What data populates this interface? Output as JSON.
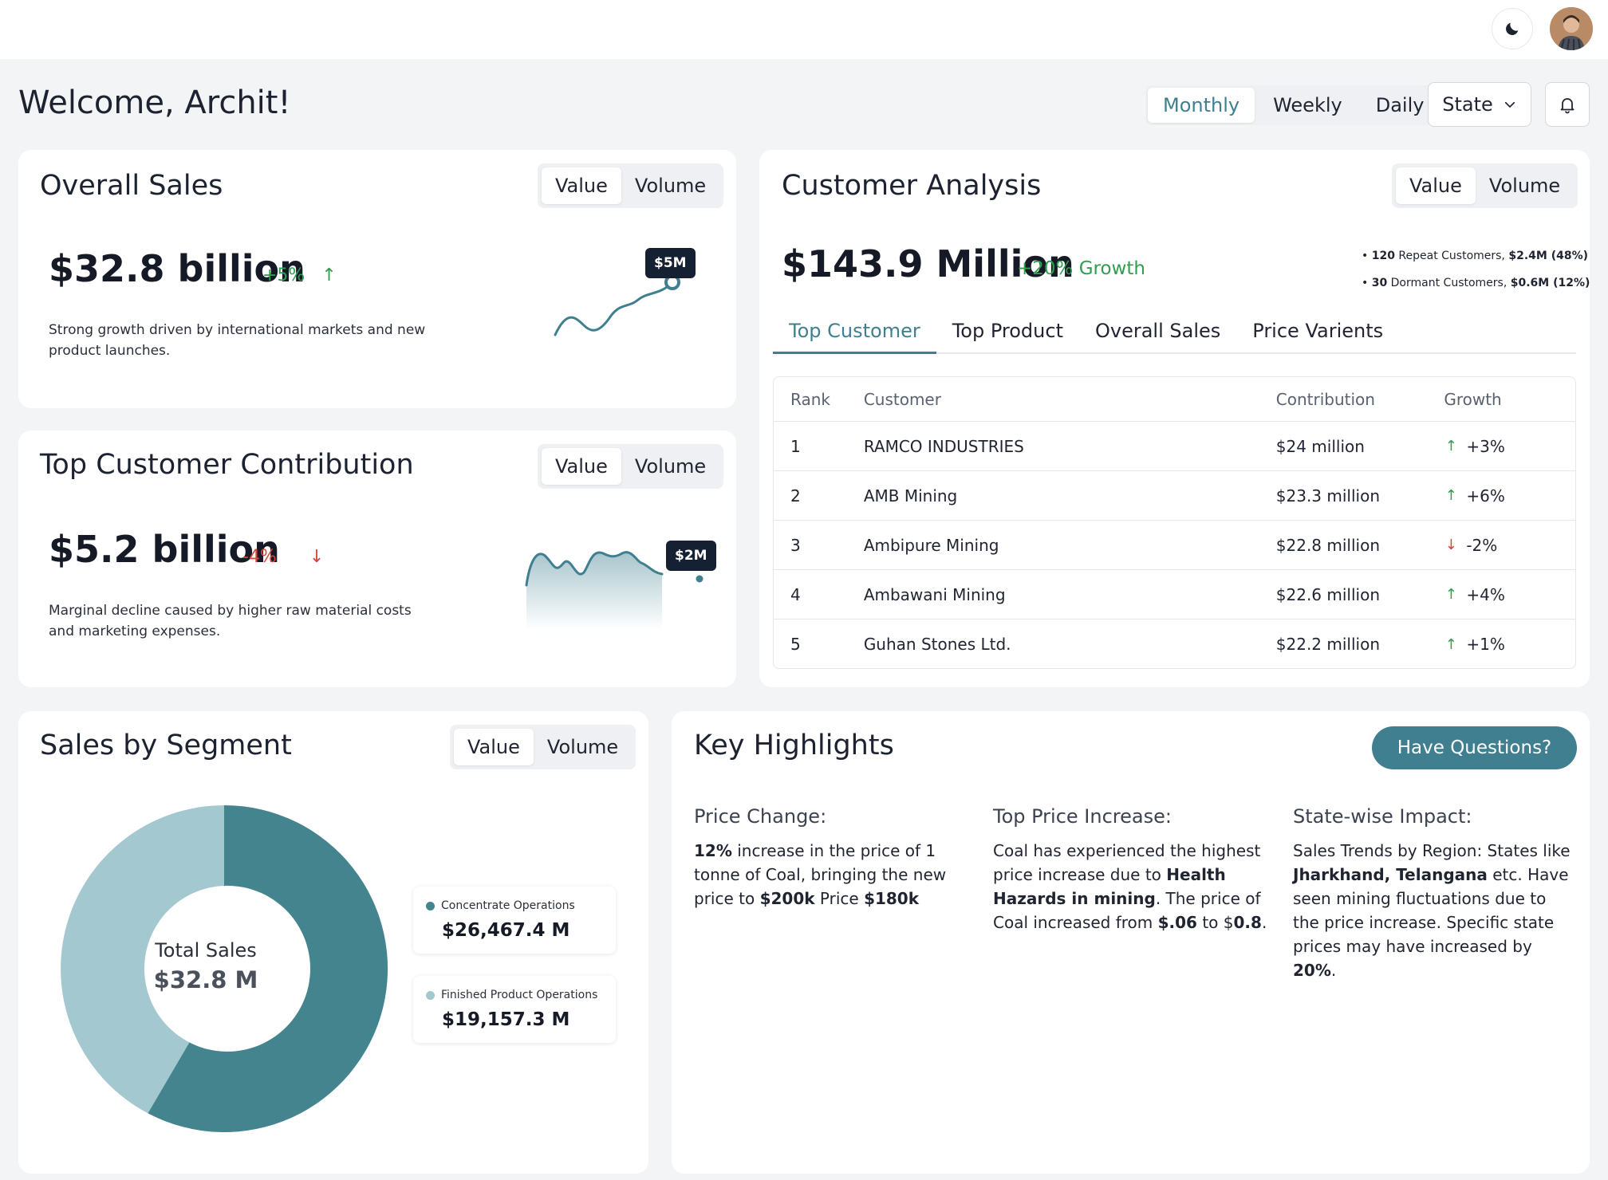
{
  "header": {
    "welcome": "Welcome, Archit!",
    "periods": [
      "Monthly",
      "Weekly",
      "Daily"
    ],
    "active_period": "Monthly",
    "state_label": "State"
  },
  "overall_sales": {
    "title": "Overall Sales",
    "toggle": [
      "Value",
      "Volume"
    ],
    "value": "$32.8 billion",
    "delta": "+5%",
    "description": "Strong growth driven by international markets and new product launches.",
    "tooltip": "$5M"
  },
  "top_customer_contribution": {
    "title": "Top Customer Contribution",
    "toggle": [
      "Value",
      "Volume"
    ],
    "value": "$5.2 billion",
    "delta": "-4%",
    "description": "Marginal decline caused by higher raw material costs and marketing expenses.",
    "tooltip": "$2M"
  },
  "customer_analysis": {
    "title": "Customer Analysis",
    "toggle": [
      "Value",
      "Volume"
    ],
    "value": "$143.9 Million",
    "growth": "+20% Growth",
    "notes": [
      {
        "count": "120",
        "text": "Repeat Customers,",
        "amount": "$2.4M (48%)"
      },
      {
        "count": "30",
        "text": "Dormant Customers,",
        "amount": "$0.6M (12%)"
      }
    ],
    "tabs": [
      "Top Customer",
      "Top Product",
      "Overall Sales",
      "Price Varients"
    ],
    "table": {
      "headers": [
        "Rank",
        "Customer",
        "Contribution",
        "Growth"
      ],
      "rows": [
        {
          "rank": "1",
          "customer": "RAMCO INDUSTRIES",
          "contribution": "$24 million",
          "growth": "+3%",
          "dir": "up"
        },
        {
          "rank": "2",
          "customer": "AMB Mining",
          "contribution": "$23.3 million",
          "growth": "+6%",
          "dir": "up"
        },
        {
          "rank": "3",
          "customer": "Ambipure Mining",
          "contribution": "$22.8 million",
          "growth": "-2%",
          "dir": "down"
        },
        {
          "rank": "4",
          "customer": "Ambawani Mining",
          "contribution": "$22.6 million",
          "growth": "+4%",
          "dir": "up"
        },
        {
          "rank": "5",
          "customer": "Guhan Stones Ltd.",
          "contribution": "$22.2 million",
          "growth": "+1%",
          "dir": "up"
        }
      ]
    }
  },
  "sales_by_segment": {
    "title": "Sales by Segment",
    "toggle": [
      "Value",
      "Volume"
    ],
    "center_label": "Total Sales",
    "center_value": "$32.8 M",
    "segments": [
      {
        "name": "Concentrate Operations",
        "value": "$26,467.4 M",
        "color": "#44848f"
      },
      {
        "name": "Finished Product Operations",
        "value": "$19,157.3 M",
        "color": "#a4c8cf"
      }
    ]
  },
  "key_highlights": {
    "title": "Key Highlights",
    "button": "Have Questions?",
    "columns": [
      {
        "title": "Price Change:",
        "body": "<b>12%</b> increase in the price of 1 tonne of Coal, bringing the new price to <b>$200k</b> Price <b>$180k</b>"
      },
      {
        "title": "Top Price Increase:",
        "body": "Coal has experienced the highest price increase due to <b>Health Hazards in mining</b>. The price of Coal increased from <b>$.06</b> to $<b>0.8</b>."
      },
      {
        "title": "State-wise Impact:",
        "body": "Sales Trends by Region: States like <b>Jharkhand, Telangana</b> etc. Have seen mining fluctuations due to the price increase. Specific state prices may have increased by <b>20%</b>."
      }
    ]
  },
  "colors": {
    "accent": "#3f7f8f",
    "positive": "#2f9e4f",
    "negative": "#d9443f"
  },
  "icons": {
    "theme": "moon-icon",
    "notifications": "bell-icon",
    "state_dropdown": "chevron-down-icon"
  }
}
